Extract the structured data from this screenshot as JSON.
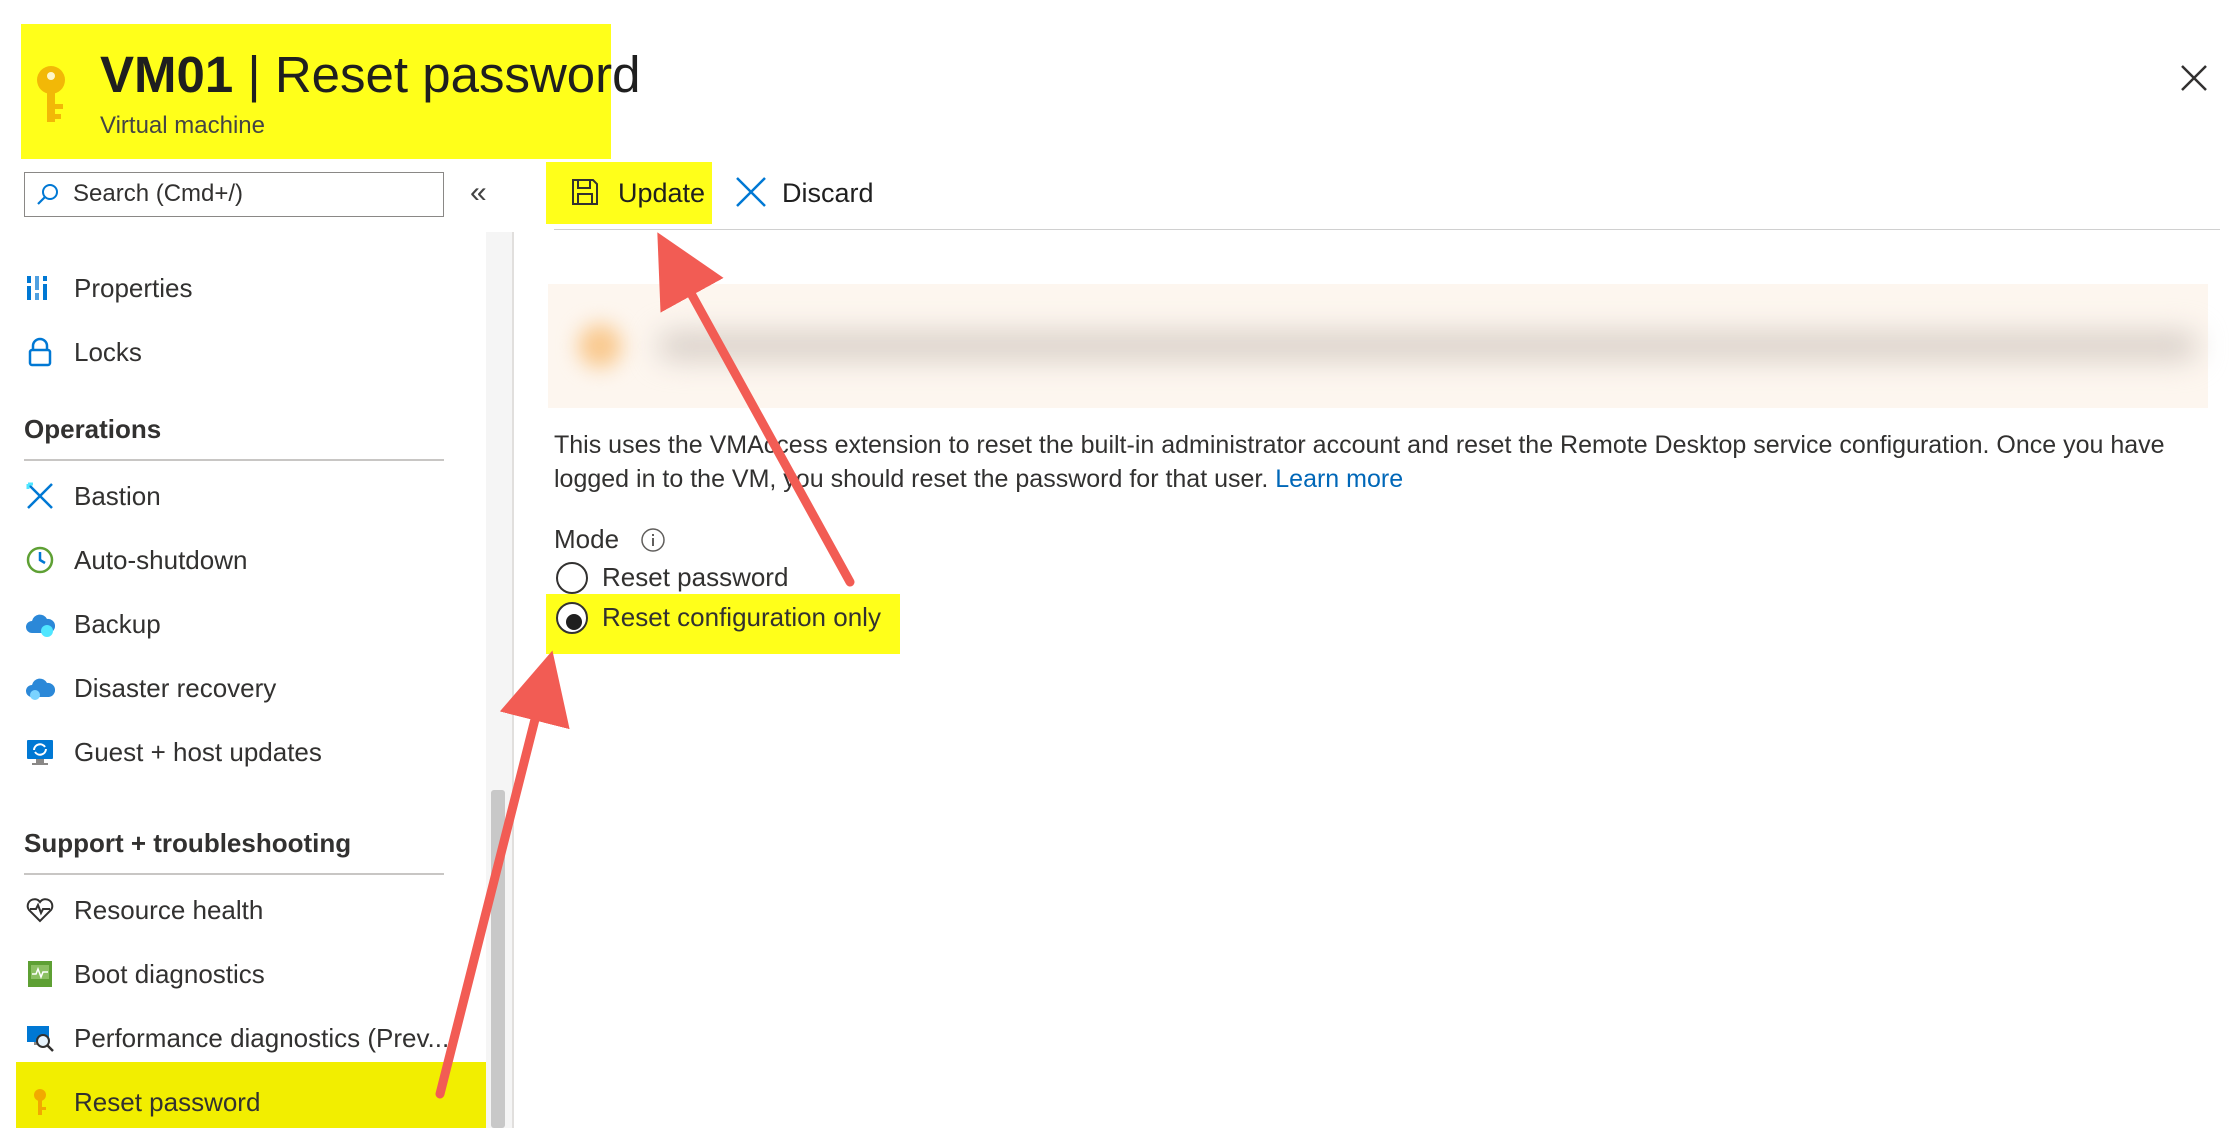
{
  "header": {
    "vm_name": "VM01",
    "separator": " | ",
    "page_name": "Reset password",
    "subtitle": "Virtual machine"
  },
  "search": {
    "placeholder": "Search (Cmd+/)"
  },
  "sidebar": {
    "items_top": [
      {
        "label": "Properties",
        "icon": "properties-icon"
      },
      {
        "label": "Locks",
        "icon": "lock-icon"
      }
    ],
    "operations_title": "Operations",
    "operations": [
      {
        "label": "Bastion",
        "icon": "bastion-icon"
      },
      {
        "label": "Auto-shutdown",
        "icon": "clock-icon"
      },
      {
        "label": "Backup",
        "icon": "backup-cloud-icon"
      },
      {
        "label": "Disaster recovery",
        "icon": "disaster-recovery-icon"
      },
      {
        "label": "Guest + host updates",
        "icon": "updates-monitor-icon"
      }
    ],
    "support_title": "Support + troubleshooting",
    "support": [
      {
        "label": "Resource health",
        "icon": "heart-pulse-icon"
      },
      {
        "label": "Boot diagnostics",
        "icon": "boot-diagnostics-icon"
      },
      {
        "label": "Performance diagnostics (Prev...",
        "icon": "performance-diagnostics-icon"
      },
      {
        "label": "Reset password",
        "icon": "key-icon",
        "active": true
      }
    ]
  },
  "toolbar": {
    "update_label": "Update",
    "discard_label": "Discard"
  },
  "main": {
    "description": "This uses the VMAccess extension to reset the built-in administrator account and reset the Remote Desktop service configuration. Once you have logged in to the VM, you should reset the password for that user. ",
    "learn_more": "Learn more",
    "mode_label": "Mode",
    "options": [
      {
        "label": "Reset password",
        "selected": false
      },
      {
        "label": "Reset configuration only",
        "selected": true
      }
    ]
  },
  "colors": {
    "highlight": "#ffff1a",
    "link": "#0067b8",
    "azure_blue": "#0078d4",
    "key_gold": "#f2b807",
    "annotation_arrow": "#f25c54"
  }
}
